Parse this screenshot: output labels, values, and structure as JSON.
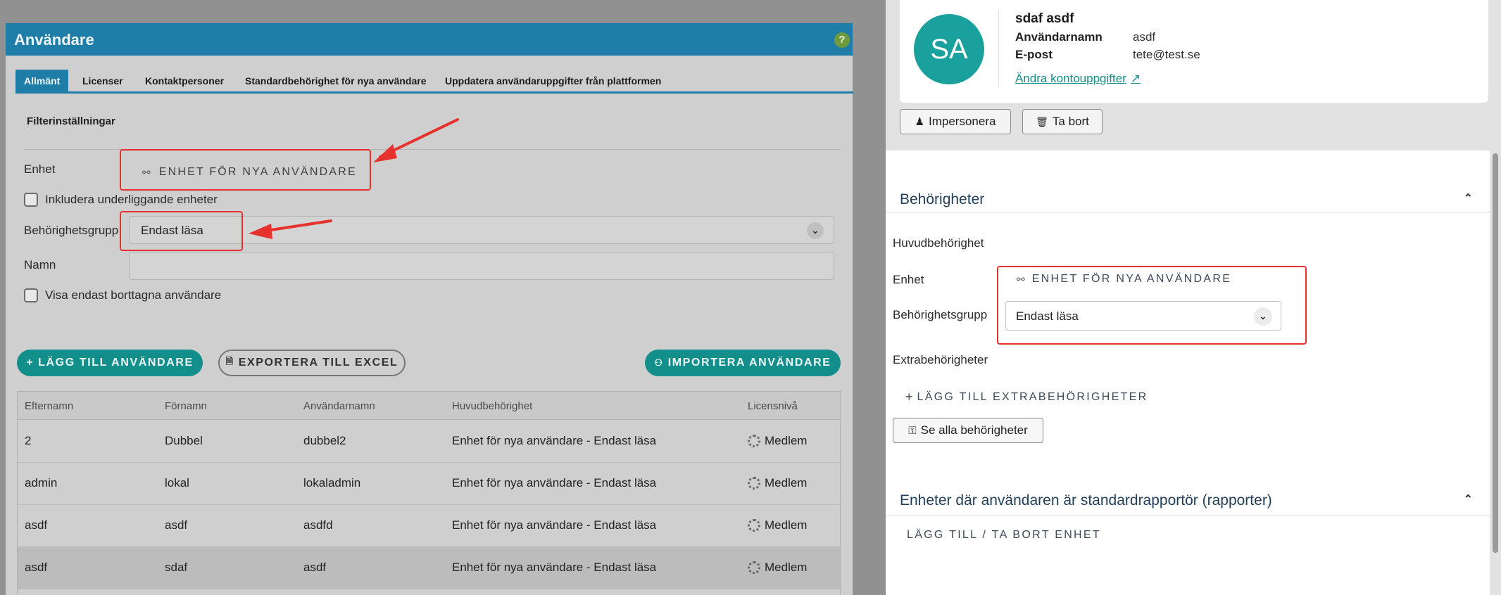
{
  "left": {
    "title": "Användare",
    "help": "?",
    "tabs": [
      "Allmänt",
      "Licenser",
      "Kontaktpersoner",
      "Standardbehörighet för nya användare",
      "Uppdatera användaruppgifter från plattformen"
    ],
    "filter_heading": "Filterinställningar",
    "enhet_label": "Enhet",
    "enhet_value": "ENHET FÖR NYA ANVÄNDARE",
    "include_sub_label": "Inkludera underliggande enheter",
    "group_label": "Behörighetsgrupp",
    "group_value": "Endast läsa",
    "name_label": "Namn",
    "name_value": "",
    "deleted_label": "Visa endast borttagna användare",
    "add_btn": "LÄGG TILL ANVÄNDARE",
    "export_btn": "EXPORTERA TILL EXCEL",
    "import_btn": "IMPORTERA ANVÄNDARE",
    "columns": [
      "Efternamn",
      "Förnamn",
      "Användarnamn",
      "Huvudbehörighet",
      "Licensnivå"
    ],
    "rows": [
      {
        "last": "2",
        "first": "Dubbel",
        "user": "dubbel2",
        "main": "Enhet för nya användare - Endast läsa",
        "license": "Medlem"
      },
      {
        "last": "admin",
        "first": "lokal",
        "user": "lokaladmin",
        "main": "Enhet för nya användare - Endast läsa",
        "license": "Medlem"
      },
      {
        "last": "asdf",
        "first": "asdf",
        "user": "asdfd",
        "main": "Enhet för nya användare - Endast läsa",
        "license": "Medlem"
      },
      {
        "last": "asdf",
        "first": "sdaf",
        "user": "asdf",
        "main": "Enhet för nya användare - Endast läsa",
        "license": "Medlem"
      }
    ]
  },
  "right": {
    "avatar_initials": "SA",
    "name": "sdaf asdf",
    "username_label": "Användarnamn",
    "username": "asdf",
    "email_label": "E-post",
    "email": "tete@test.se",
    "account_link": "Ändra kontouppgifter",
    "impersonate_btn": "Impersonera",
    "delete_btn": "Ta bort",
    "permissions_title": "Behörigheter",
    "main_perm_label": "Huvudbehörighet",
    "enhet_label": "Enhet",
    "enhet_value": "ENHET FÖR NYA ANVÄNDARE",
    "group_label": "Behörighetsgrupp",
    "group_value": "Endast läsa",
    "extra_label": "Extrabehörigheter",
    "add_extra": "LÄGG TILL EXTRABEHÖRIGHETER",
    "see_all_btn": "Se alla behörigheter",
    "reporter_title": "Enheter där användaren är standardrapportör (rapporter)",
    "add_remove_unit": "LÄGG TILL / TA BORT ENHET"
  },
  "colors": {
    "header_blue": "#1f7ea8",
    "teal": "#128f8a",
    "annotation_red": "#e5322d"
  }
}
